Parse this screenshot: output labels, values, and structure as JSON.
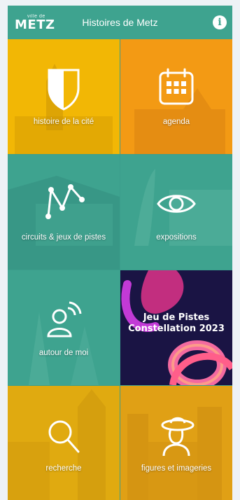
{
  "header": {
    "logo_small": "ville de",
    "logo_main": "METZ",
    "title": "Histoires de Metz",
    "info_glyph": "i"
  },
  "tiles": [
    {
      "label": "histoire de la cité",
      "icon": "shield-icon",
      "color": "#f2b705"
    },
    {
      "label": "agenda",
      "icon": "calendar-icon",
      "color": "#f39a14"
    },
    {
      "label": "circuits & jeux de pistes",
      "icon": "route-icon",
      "color": "#3ea38f"
    },
    {
      "label": "expositions",
      "icon": "eye-icon",
      "color": "#3ea38f"
    },
    {
      "label": "autour de moi",
      "icon": "location-person-icon",
      "color": "#3ea38f"
    },
    {
      "promo_line1": "Jeu de Pistes",
      "promo_line2": "Constellation 2023",
      "icon": "promo-image",
      "color": "#1a1444"
    },
    {
      "label": "recherche",
      "icon": "search-icon",
      "color": "#e0aa10"
    },
    {
      "label": "figures et imageries",
      "icon": "lady-hat-icon",
      "color": "#e0a015"
    }
  ]
}
